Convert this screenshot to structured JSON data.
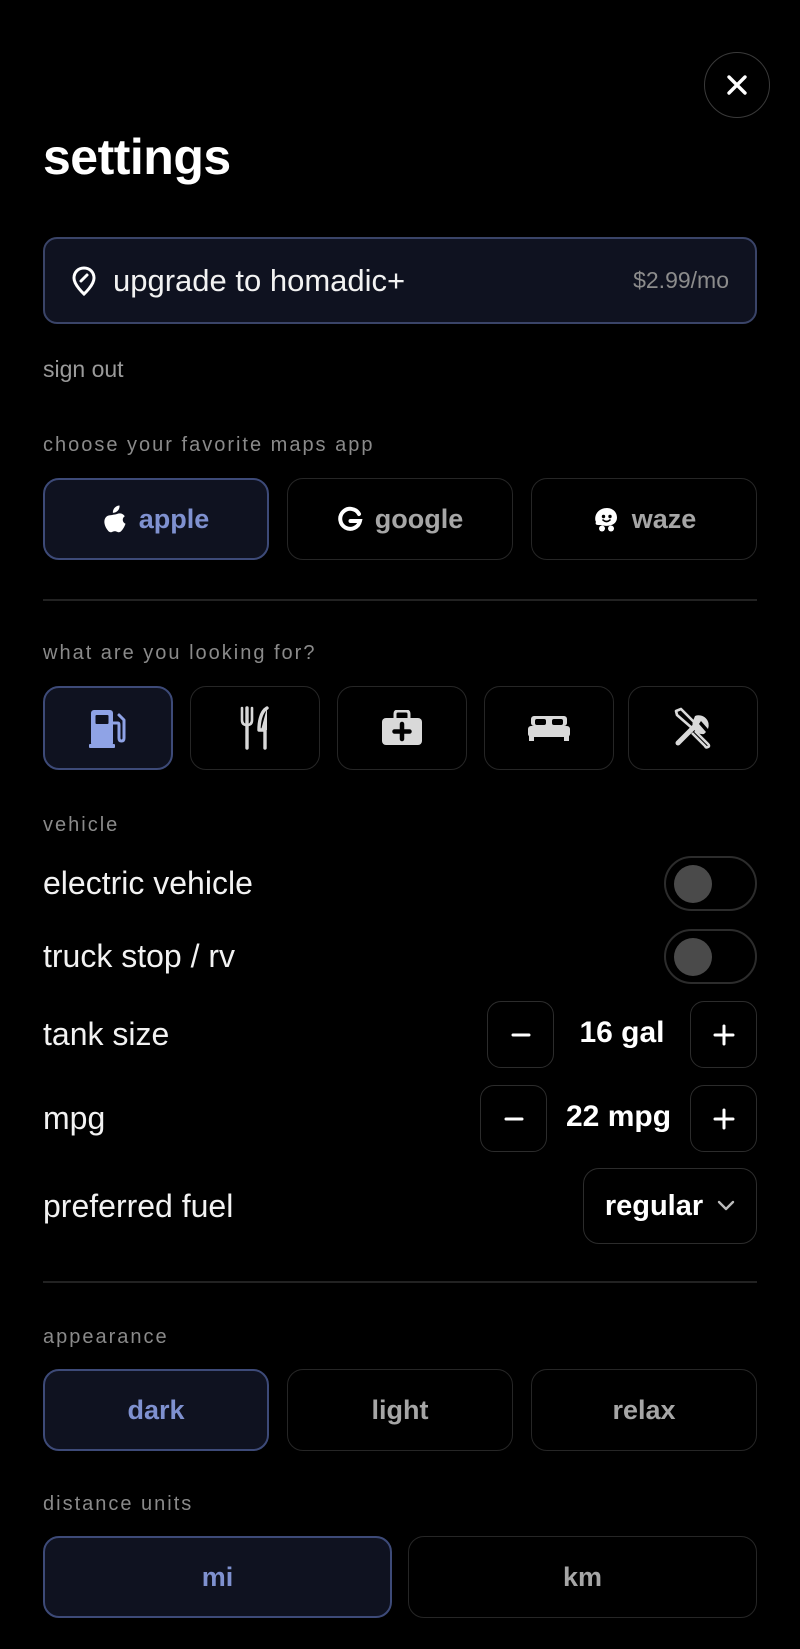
{
  "header": {
    "title": "settings",
    "close_icon": "close-icon"
  },
  "upgrade": {
    "label": "upgrade to homadic+",
    "price": "$2.99/mo",
    "icon": "location-pin-icon"
  },
  "account": {
    "signout_label": "sign out"
  },
  "maps": {
    "section_label": "choose your favorite maps app",
    "options": [
      {
        "label": "apple",
        "icon": "apple-icon",
        "selected": true
      },
      {
        "label": "google",
        "icon": "google-icon",
        "selected": false
      },
      {
        "label": "waze",
        "icon": "waze-icon",
        "selected": false
      }
    ]
  },
  "categories": {
    "section_label": "what are you looking for?",
    "items": [
      {
        "icon": "gas-pump-icon",
        "selected": true
      },
      {
        "icon": "fork-knife-icon",
        "selected": false
      },
      {
        "icon": "medical-kit-icon",
        "selected": false
      },
      {
        "icon": "bed-icon",
        "selected": false
      },
      {
        "icon": "tools-icon",
        "selected": false
      }
    ]
  },
  "vehicle": {
    "section_label": "vehicle",
    "electric_vehicle": {
      "label": "electric vehicle",
      "on": false
    },
    "truck_stop": {
      "label": "truck stop / rv",
      "on": false
    },
    "tank_size": {
      "label": "tank size",
      "value": "16 gal"
    },
    "mpg": {
      "label": "mpg",
      "value": "22 mpg"
    },
    "preferred_fuel": {
      "label": "preferred fuel",
      "value": "regular"
    }
  },
  "appearance": {
    "section_label": "appearance",
    "options": [
      {
        "label": "dark",
        "selected": true
      },
      {
        "label": "light",
        "selected": false
      },
      {
        "label": "relax",
        "selected": false
      }
    ]
  },
  "distance_units": {
    "section_label": "distance units",
    "options": [
      {
        "label": "mi",
        "selected": true
      },
      {
        "label": "km",
        "selected": false
      }
    ]
  },
  "colors": {
    "accent": "#7f91d0",
    "active_bg": "#0f1220",
    "active_border": "#3d4a78"
  }
}
